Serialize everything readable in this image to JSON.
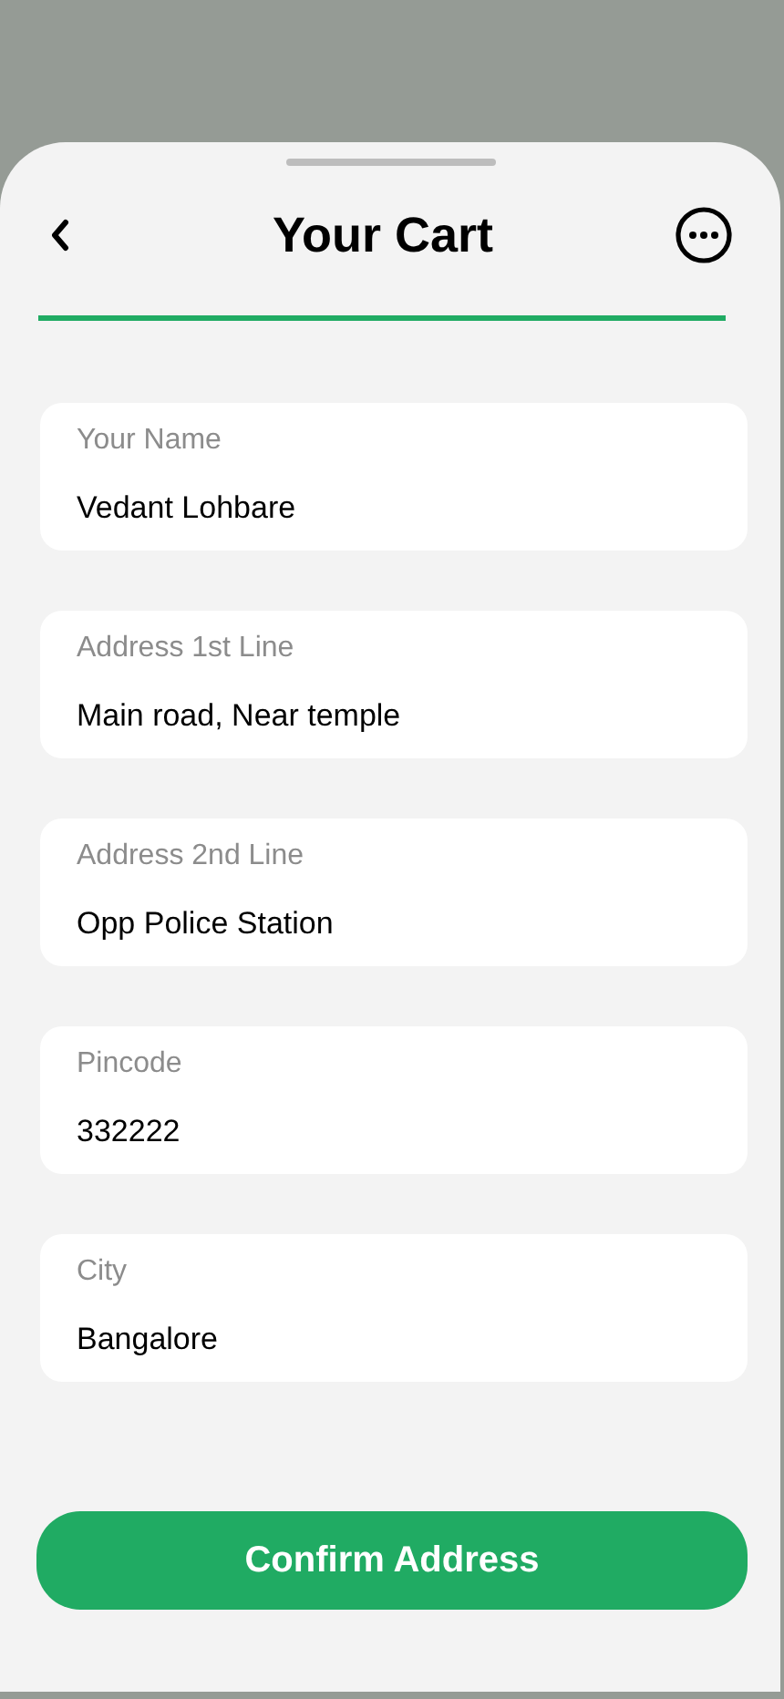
{
  "header": {
    "title": "Your Cart"
  },
  "fields": [
    {
      "label": "Your Name",
      "value": "Vedant Lohbare"
    },
    {
      "label": "Address 1st Line",
      "value": "Main road, Near temple"
    },
    {
      "label": "Address 2nd Line",
      "value": "Opp Police Station"
    },
    {
      "label": "Pincode",
      "value": "332222"
    },
    {
      "label": "City",
      "value": "Bangalore"
    }
  ],
  "button": {
    "label": "Confirm Address"
  }
}
